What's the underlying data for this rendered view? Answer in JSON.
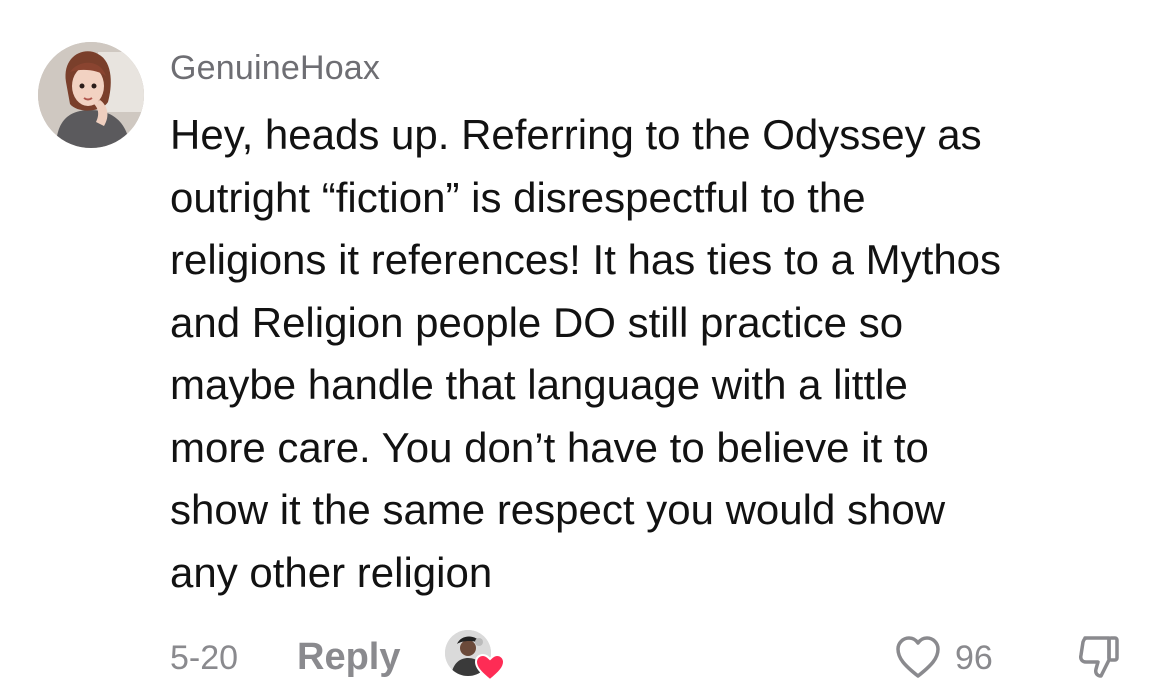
{
  "comment": {
    "username": "GenuineHoax",
    "body_lines": [
      "Hey, heads up. Referring to the Odyssey as",
      "outright “fiction” is disrespectful to the",
      "religions it references! It has ties to a Mythos",
      "and Religion people DO still practice so",
      "maybe handle that language with a little",
      "more care. You don’t have to believe it to",
      "show it the same respect you would show",
      "any other religion"
    ],
    "date": "5-20",
    "reply_label": "Reply",
    "like_count": "96",
    "creator_liked": true
  },
  "icons": {
    "avatar": "user-avatar",
    "creator_avatar": "creator-avatar",
    "creator_heart": "heart-filled-icon",
    "like": "heart-outline-icon",
    "dislike": "thumbs-down-icon"
  },
  "colors": {
    "username": "#6e6e73",
    "text": "#121212",
    "meta": "#8a8a8e",
    "creator_heart": "#fe2c55"
  }
}
